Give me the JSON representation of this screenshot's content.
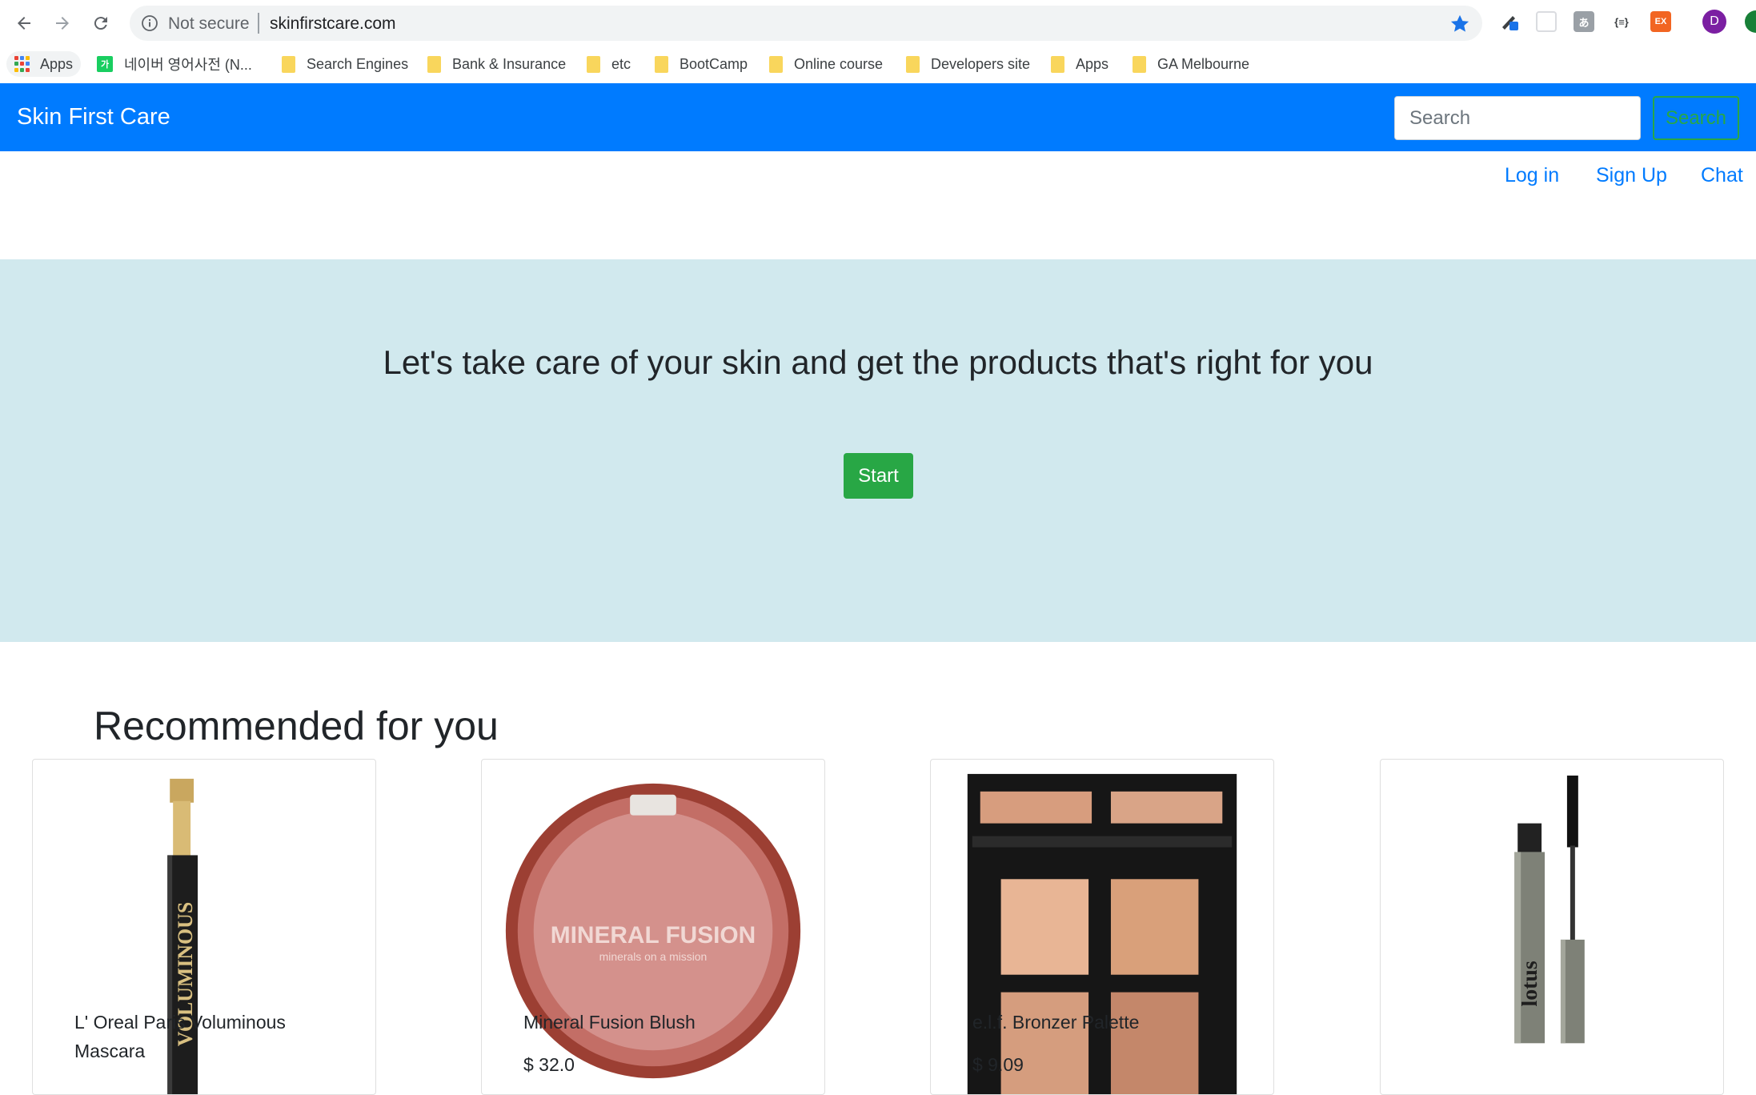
{
  "browser": {
    "security_label": "Not secure",
    "url": "skinfirstcare.com",
    "profile_initial": "D",
    "extensions": [
      "pen-extension-icon",
      "screenshot-extension-icon",
      "translate-extension-icon",
      "json-extension-icon",
      "ex-extension-icon"
    ],
    "ext_labels": {
      "json": "{≡}",
      "ex": "EX",
      "translate": "あ"
    }
  },
  "bookmarks": {
    "apps_label": "Apps",
    "naver_label": "네이버 영어사전 (N...",
    "naver_icon_text": "가",
    "folders": [
      "Search Engines",
      "Bank & Insurance",
      "etc",
      "BootCamp",
      "Online course",
      "Developers site",
      "Apps",
      "GA Melbourne"
    ]
  },
  "navbar": {
    "brand": "Skin First Care",
    "search_placeholder": "Search",
    "search_button": "Search"
  },
  "links": {
    "login": "Log in",
    "signup": "Sign Up",
    "chat": "Chat"
  },
  "hero": {
    "title": "Let's take care of your skin and get the products that's right for you",
    "start_button": "Start"
  },
  "recommended": {
    "title": "Recommended for you",
    "products": [
      {
        "name": "L' Oreal Paris Voluminous Mascara",
        "price": ""
      },
      {
        "name": "Mineral Fusion Blush",
        "price": "$ 32.0"
      },
      {
        "name": "e.l.f. Bronzer Palette",
        "price": "$ 9.09"
      },
      {
        "name": "",
        "price": ""
      }
    ],
    "image_text": {
      "voluminous": "VOLUMINOUS",
      "mineral_fusion_brand": "MINERAL FUSION",
      "mineral_fusion_tag": "minerals on a mission",
      "lotus": "lotus"
    }
  },
  "colors": {
    "primary": "#007bff",
    "success": "#28a745",
    "jumbotron": "#d1e9ee"
  }
}
